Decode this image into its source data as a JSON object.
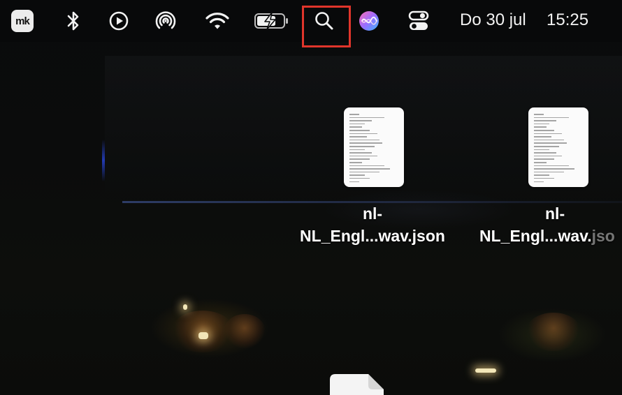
{
  "menubar": {
    "app_logo_text": "mk",
    "icons": [
      "bluetooth-icon",
      "play-circle-icon",
      "airdrop-icon",
      "wifi-icon",
      "battery-charging-icon",
      "spotlight-search-icon",
      "siri-icon",
      "control-center-icon"
    ],
    "date": "Do 30 jul",
    "time": "15:25",
    "highlight_color": "#e0352b"
  },
  "desktop": {
    "files": [
      {
        "name_line1": "nl-",
        "name_line2": "NL_Engl...wav.json"
      },
      {
        "name_line1": "nl-",
        "name_line2_visible": "NL_Engl...wav.",
        "name_line2_faded": "jso"
      }
    ]
  }
}
